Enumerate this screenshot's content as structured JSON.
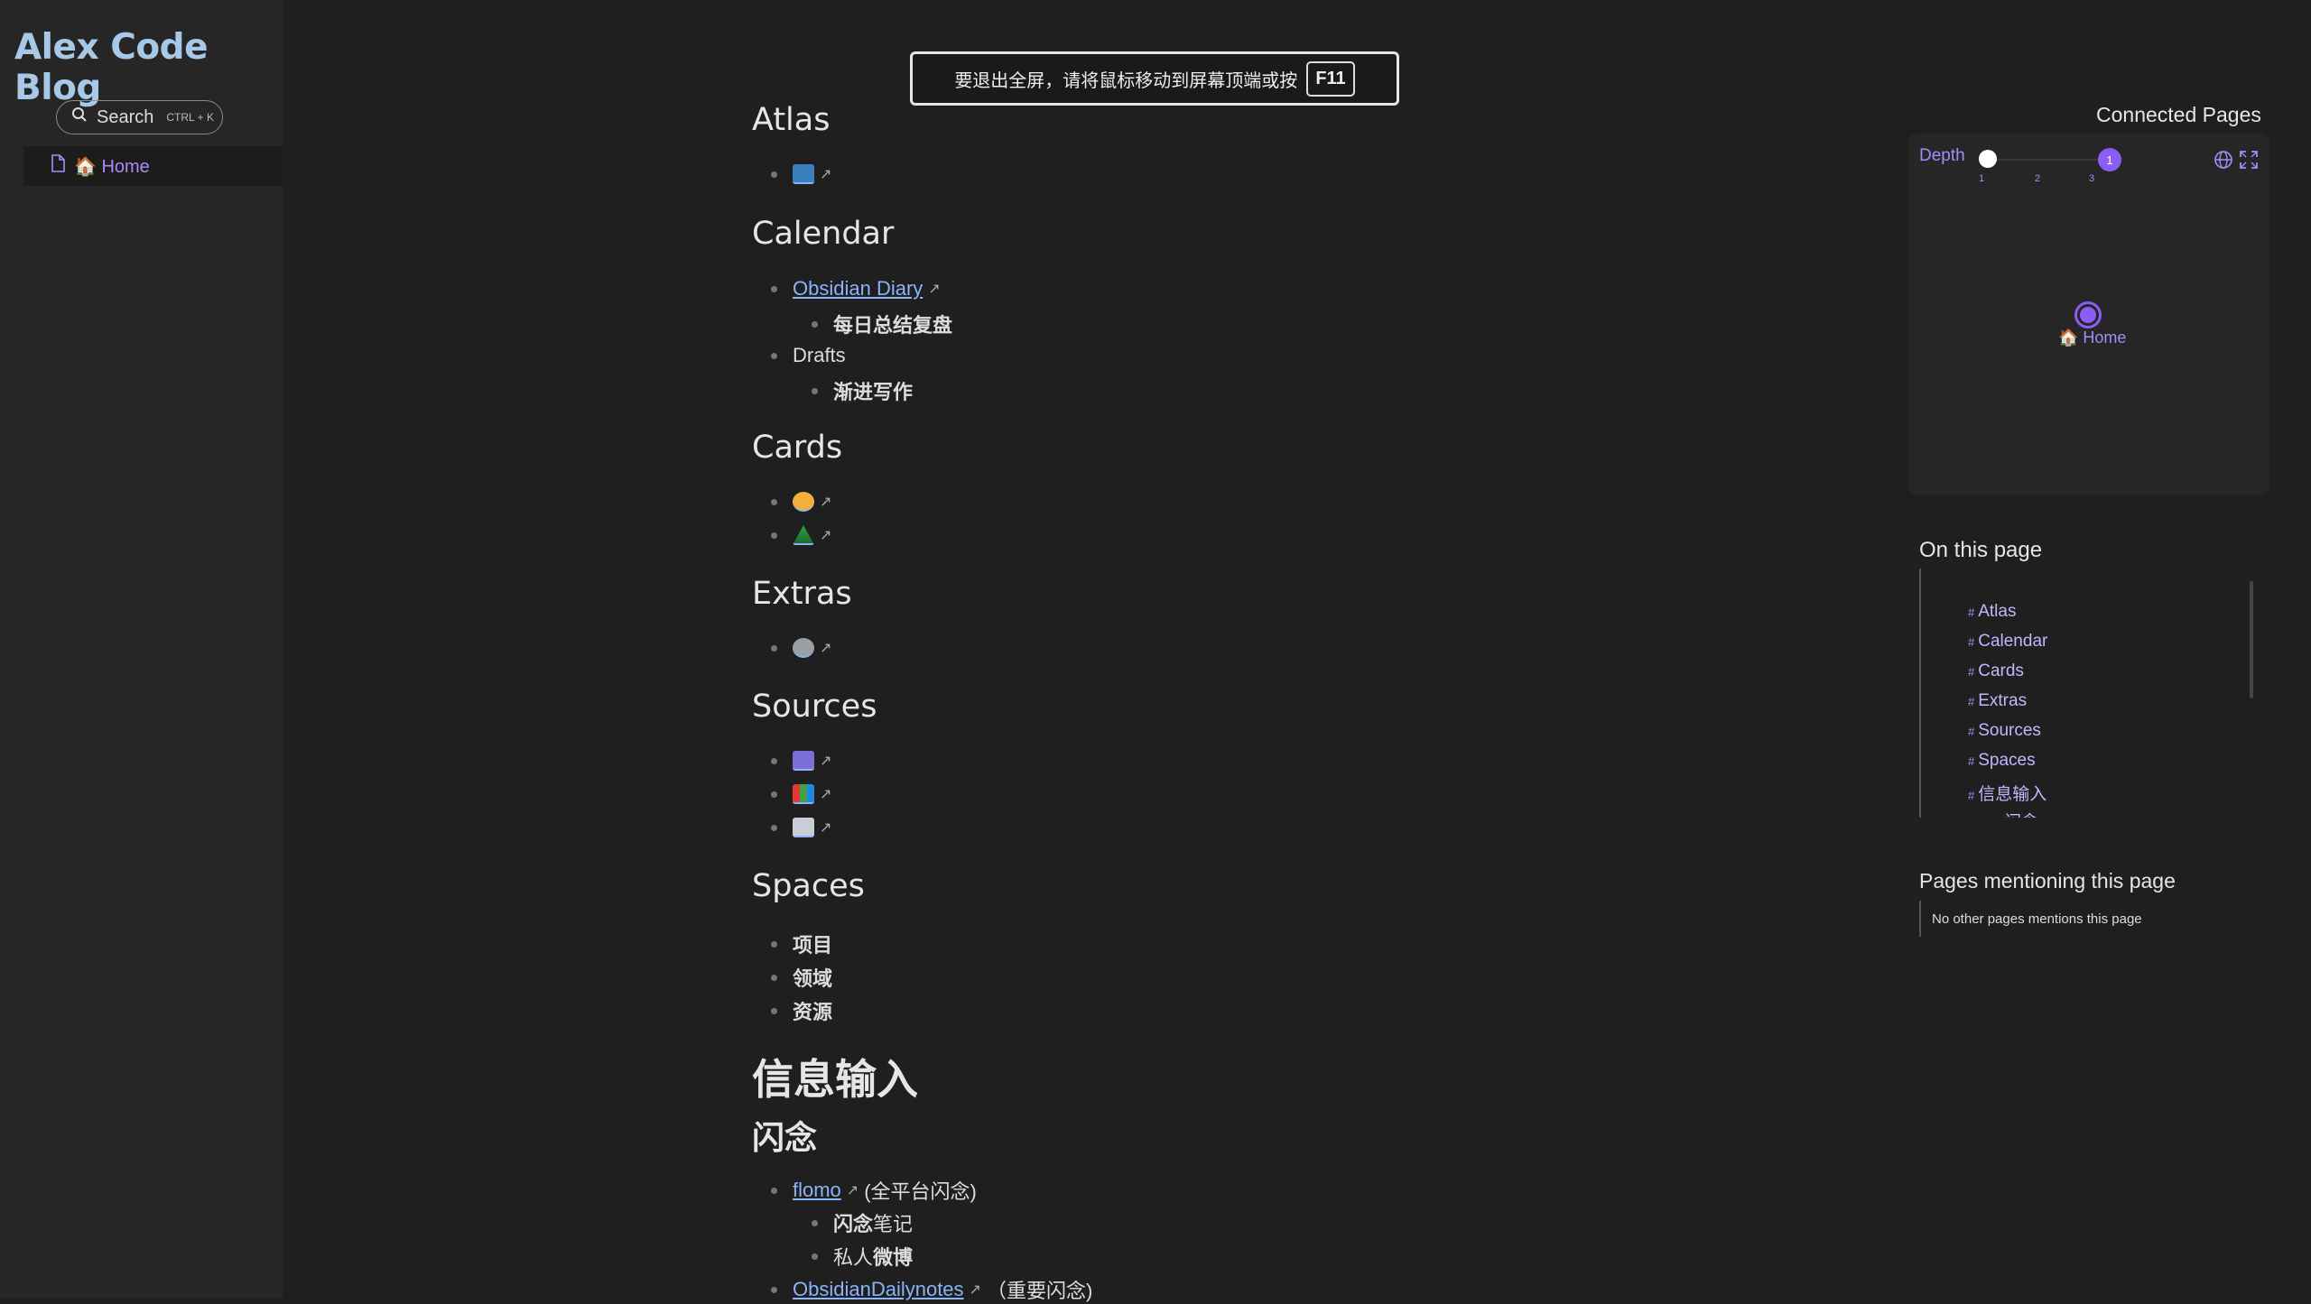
{
  "site": {
    "title": "Alex Code Blog"
  },
  "search": {
    "label": "Search",
    "shortcut": "CTRL + K"
  },
  "nav": {
    "home_label": "🏠 Home"
  },
  "toast": {
    "message": "要退出全屏，请将鼠标移动到屏幕顶端或按",
    "key": "F11"
  },
  "sections": {
    "atlas": "Atlas",
    "calendar": "Calendar",
    "obsidian_diary": "Obsidian Diary",
    "daily_review": "每日总结复盘",
    "drafts": "Drafts",
    "progressive_writing": "渐进写作",
    "cards": "Cards",
    "extras": "Extras",
    "sources": "Sources",
    "spaces": "Spaces",
    "project": "项目",
    "area": "领域",
    "resource": "资源",
    "info_input": "信息输入",
    "flash": "闪念",
    "flomo": "flomo",
    "flomo_note": "(全平台闪念)",
    "flash_notes_a": "闪念",
    "flash_notes_b": "笔记",
    "private_weibo_a": "私人",
    "private_weibo_b": "微博",
    "dailynotes": "ObsidianDailynotes",
    "dailynotes_note": "（重要闪念)"
  },
  "graph": {
    "title": "Connected Pages",
    "depth_label": "Depth",
    "depth_value": "1",
    "ticks": [
      "1",
      "2",
      "3"
    ],
    "node_label": "🏠 Home"
  },
  "toc": {
    "title": "On this page",
    "items": [
      "Atlas",
      "Calendar",
      "Cards",
      "Extras",
      "Sources",
      "Spaces",
      "信息输入",
      "闪念"
    ]
  },
  "mentions": {
    "title": "Pages mentioning this page",
    "empty": "No other pages mentions this page"
  },
  "colors": {
    "accent": "#a78bfa",
    "link": "#8ab4f8",
    "background": "#1f1f1f",
    "sidebar": "#262626"
  }
}
